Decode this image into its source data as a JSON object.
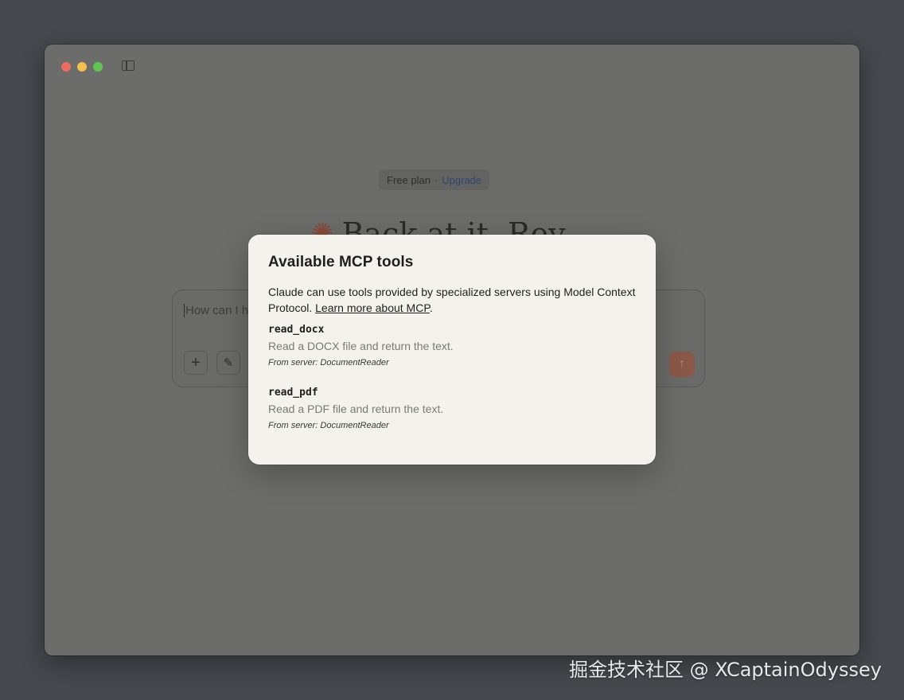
{
  "window": {
    "controls": [
      "close",
      "minimize",
      "maximize"
    ],
    "sidebar_toggle_icon": "sidebar-icon"
  },
  "plan": {
    "label": "Free plan",
    "separator": "·",
    "upgrade_label": "Upgrade"
  },
  "greeting": {
    "icon": "claude-spark-icon",
    "text": "Back at it, Rey"
  },
  "composer": {
    "placeholder": "How can I h",
    "add_icon": "+",
    "style_icon": "✎",
    "send_icon": "↑"
  },
  "modal": {
    "title": "Available MCP tools",
    "description": "Claude can use tools provided by specialized servers using Model Context Protocol.",
    "link_label": "Learn more about MCP",
    "link_suffix": ".",
    "tools": [
      {
        "name": "read_docx",
        "description": "Read a DOCX file and return the text.",
        "server": "From server: DocumentReader"
      },
      {
        "name": "read_pdf",
        "description": "Read a PDF file and return the text.",
        "server": "From server: DocumentReader"
      }
    ]
  },
  "watermark": "掘金技术社区 @ XCaptainOdyssey"
}
